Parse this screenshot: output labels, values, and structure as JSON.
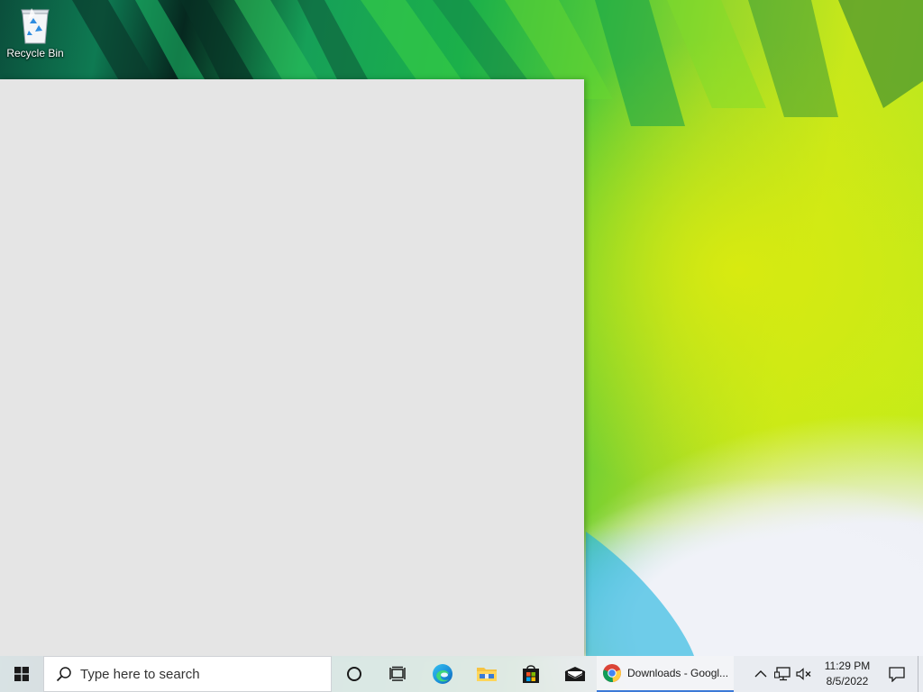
{
  "desktop": {
    "icons": [
      {
        "label": "Recycle Bin",
        "icon": "recycle-bin-icon"
      }
    ]
  },
  "taskbar": {
    "start_icon": "windows-logo-icon",
    "search": {
      "placeholder": "Type here to search",
      "icon": "search-icon"
    },
    "pinned": [
      {
        "name": "cortana",
        "icon": "cortana-circle-icon"
      },
      {
        "name": "task-view",
        "icon": "task-view-icon"
      },
      {
        "name": "edge",
        "icon": "edge-icon"
      },
      {
        "name": "file-explorer",
        "icon": "folder-icon"
      },
      {
        "name": "store",
        "icon": "store-bag-icon"
      },
      {
        "name": "mail",
        "icon": "mail-icon"
      }
    ],
    "active_task": {
      "label": "Downloads - Googl...",
      "icon": "chrome-icon"
    },
    "tray": {
      "chevron_icon": "chevron-up-icon",
      "network_icon": "network-icon",
      "volume_icon": "volume-muted-icon",
      "time": "11:29 PM",
      "date": "8/5/2022",
      "notification_icon": "notification-icon"
    }
  },
  "colors": {
    "taskbar_bg": "#e8ecf0",
    "window_bg": "#e5e5e5",
    "accent": "#3c7ad8"
  }
}
